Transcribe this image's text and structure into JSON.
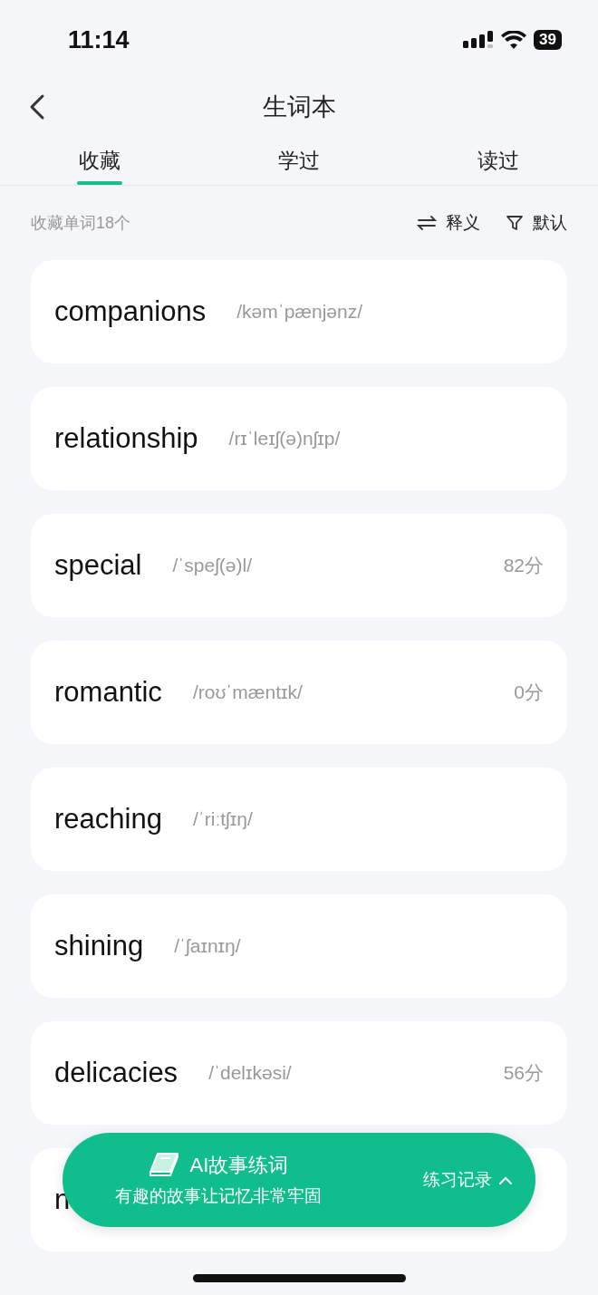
{
  "status_bar": {
    "time": "11:14",
    "battery": "39"
  },
  "nav": {
    "title": "生词本"
  },
  "tabs": [
    {
      "label": "收藏",
      "selected": true
    },
    {
      "label": "学过",
      "selected": false
    },
    {
      "label": "读过",
      "selected": false
    }
  ],
  "summary": "收藏单词18个",
  "actions": [
    {
      "kind": "swap",
      "label": "释义"
    },
    {
      "kind": "filter",
      "label": "默认"
    }
  ],
  "words": [
    {
      "word": "companions",
      "phonetic": "/kəmˈpænjənz/"
    },
    {
      "word": "relationship",
      "phonetic": "/rɪˈleɪʃ(ə)nʃɪp/"
    },
    {
      "word": "special",
      "phonetic": "/ˈspeʃ(ə)l/",
      "score": "82分"
    },
    {
      "word": "romantic",
      "phonetic": "/roʊˈmæntɪk/",
      "score": "0分"
    },
    {
      "word": "reaching",
      "phonetic": "/ˈriːtʃɪŋ/"
    },
    {
      "word": "shining",
      "phonetic": "/ˈʃaɪnɪŋ/"
    },
    {
      "word": "delicacies",
      "phonetic": "/ˈdelɪkəsi/",
      "score": "56分"
    },
    {
      "word": "n"
    }
  ],
  "practice_bar": {
    "title": "AI故事练词",
    "subtitle": "有趣的故事让记忆非常牢固",
    "link": "练习记录"
  }
}
